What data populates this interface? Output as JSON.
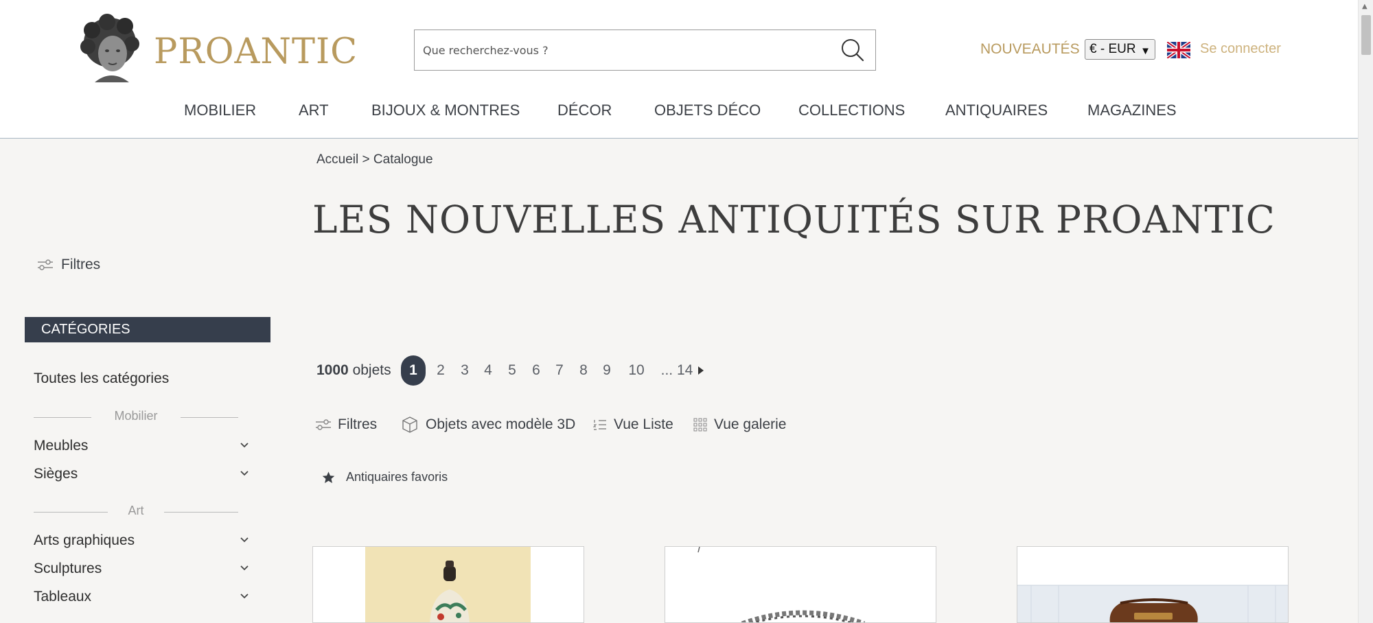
{
  "header": {
    "logo_text": "PROANTIC",
    "search_placeholder": "Que recherchez-vous ?",
    "nouveautes": "NOUVEAUTÉS",
    "currency": "€ - EUR",
    "login": "Se connecter"
  },
  "nav": [
    "MOBILIER",
    "ART",
    "BIJOUX & MONTRES",
    "DÉCOR",
    "OBJETS DÉCO",
    "COLLECTIONS",
    "ANTIQUAIRES",
    "MAGAZINES"
  ],
  "breadcrumb": "Accueil > Catalogue",
  "page_title": "LES NOUVELLES ANTIQUITÉS SUR PROANTIC",
  "sidebar": {
    "filter_label": "Filtres",
    "categories_header": "CATÉGORIES",
    "all_categories": "Toutes les catégories",
    "groups": [
      {
        "label": "Mobilier",
        "items": [
          "Meubles",
          "Sièges"
        ]
      },
      {
        "label": "Art",
        "items": [
          "Arts graphiques",
          "Sculptures",
          "Tableaux"
        ]
      }
    ]
  },
  "results": {
    "count_number": "1000",
    "count_label": "objets",
    "pages": [
      "1",
      "2",
      "3",
      "4",
      "5",
      "6",
      "7",
      "8",
      "9",
      "10",
      "... 14"
    ],
    "active_page": "1"
  },
  "toolbar": {
    "filters": "Filtres",
    "objects_3d": "Objets avec modèle 3D",
    "list_view": "Vue Liste",
    "gallery_view": "Vue galerie"
  },
  "favorites": "Antiquaires favoris",
  "colors": {
    "gold": "#b89a5e",
    "dark_navy": "#363e4c",
    "page_bg": "#f6f5f3"
  }
}
